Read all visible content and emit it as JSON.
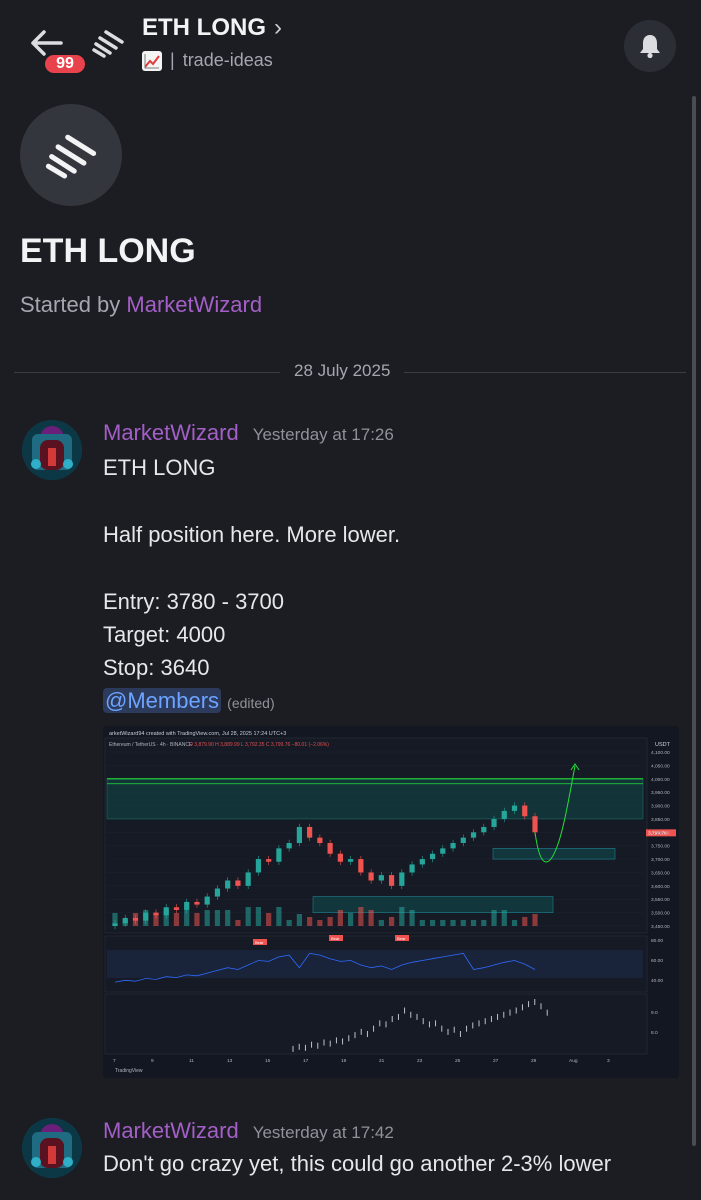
{
  "topbar": {
    "badge_count": "99",
    "thread_title": "ETH LONG",
    "chevron": "›",
    "channel_separator": "|",
    "channel_name": "trade-ideas",
    "icons": [
      "back-arrow-icon",
      "thread-logo-icon",
      "chart-increasing-emoji",
      "bell-icon"
    ]
  },
  "thread": {
    "title": "ETH LONG",
    "started_prefix": "Started by",
    "started_by": "MarketWizard"
  },
  "date_divider": "28 July 2025",
  "messages": [
    {
      "author": "MarketWizard",
      "time": "Yesterday at 17:26",
      "lines": [
        "ETH LONG",
        "",
        "Half position here. More lower.",
        "",
        "Entry: 3780 - 3700",
        "Target: 4000",
        "Stop: 3640"
      ],
      "mention": "@Members",
      "edited": "(edited)"
    },
    {
      "author": "MarketWizard",
      "time": "Yesterday at 17:42",
      "lines": [
        "Don't go crazy yet, this could go another 2-3% lower"
      ]
    }
  ],
  "attachment": {
    "header_line": "arketWizard94 created with TradingView.com, Jul 28, 2025 17:24 UTC+3",
    "symbol_line": "Ethereum / TetherUS · 4h · BINANCE",
    "ohlc": "O 3,879.90  H 3,889.99  L 3,792.35  C 3,799.76  −80.01 (−2.06%)",
    "currency": "USDT",
    "watermark": "TradingView",
    "price_labels": [
      "4,100.00",
      "4,050.00",
      "4,000.00",
      "3,950.00",
      "3,900.00",
      "3,850.00",
      "3,799.76",
      "3,750.00",
      "3,700.00",
      "3,650.00",
      "3,600.00",
      "3,550.00",
      "3,500.00",
      "3,450.00"
    ],
    "rsi_labels": [
      "80.00",
      "60.00",
      "40.00"
    ],
    "lower_labels": [
      "9.0",
      "8.0"
    ],
    "x_labels": [
      "7",
      "9",
      "11",
      "13",
      "15",
      "17",
      "19",
      "21",
      "23",
      "25",
      "27",
      "29",
      "Aug",
      "3"
    ],
    "bear_tag": "Bear",
    "chart_data": {
      "type": "candlestick",
      "symbol": "Ethereum / TetherUS",
      "interval": "4h",
      "last_price": 3799.76,
      "ylim": [
        3450,
        4100
      ],
      "levels": {
        "target": 4000,
        "upper_zone": [
          3850,
          4000
        ],
        "entry_zone": [
          3700,
          3740
        ],
        "demand_zone": [
          3500,
          3560
        ]
      },
      "rsi_ylim": [
        30,
        90
      ],
      "closes": [
        3460,
        3480,
        3470,
        3500,
        3490,
        3520,
        3510,
        3540,
        3530,
        3560,
        3590,
        3620,
        3600,
        3650,
        3700,
        3690,
        3740,
        3760,
        3820,
        3780,
        3760,
        3720,
        3690,
        3700,
        3650,
        3620,
        3640,
        3600,
        3650,
        3680,
        3700,
        3720,
        3740,
        3760,
        3780,
        3800,
        3820,
        3850,
        3880,
        3900,
        3860,
        3800
      ]
    }
  }
}
